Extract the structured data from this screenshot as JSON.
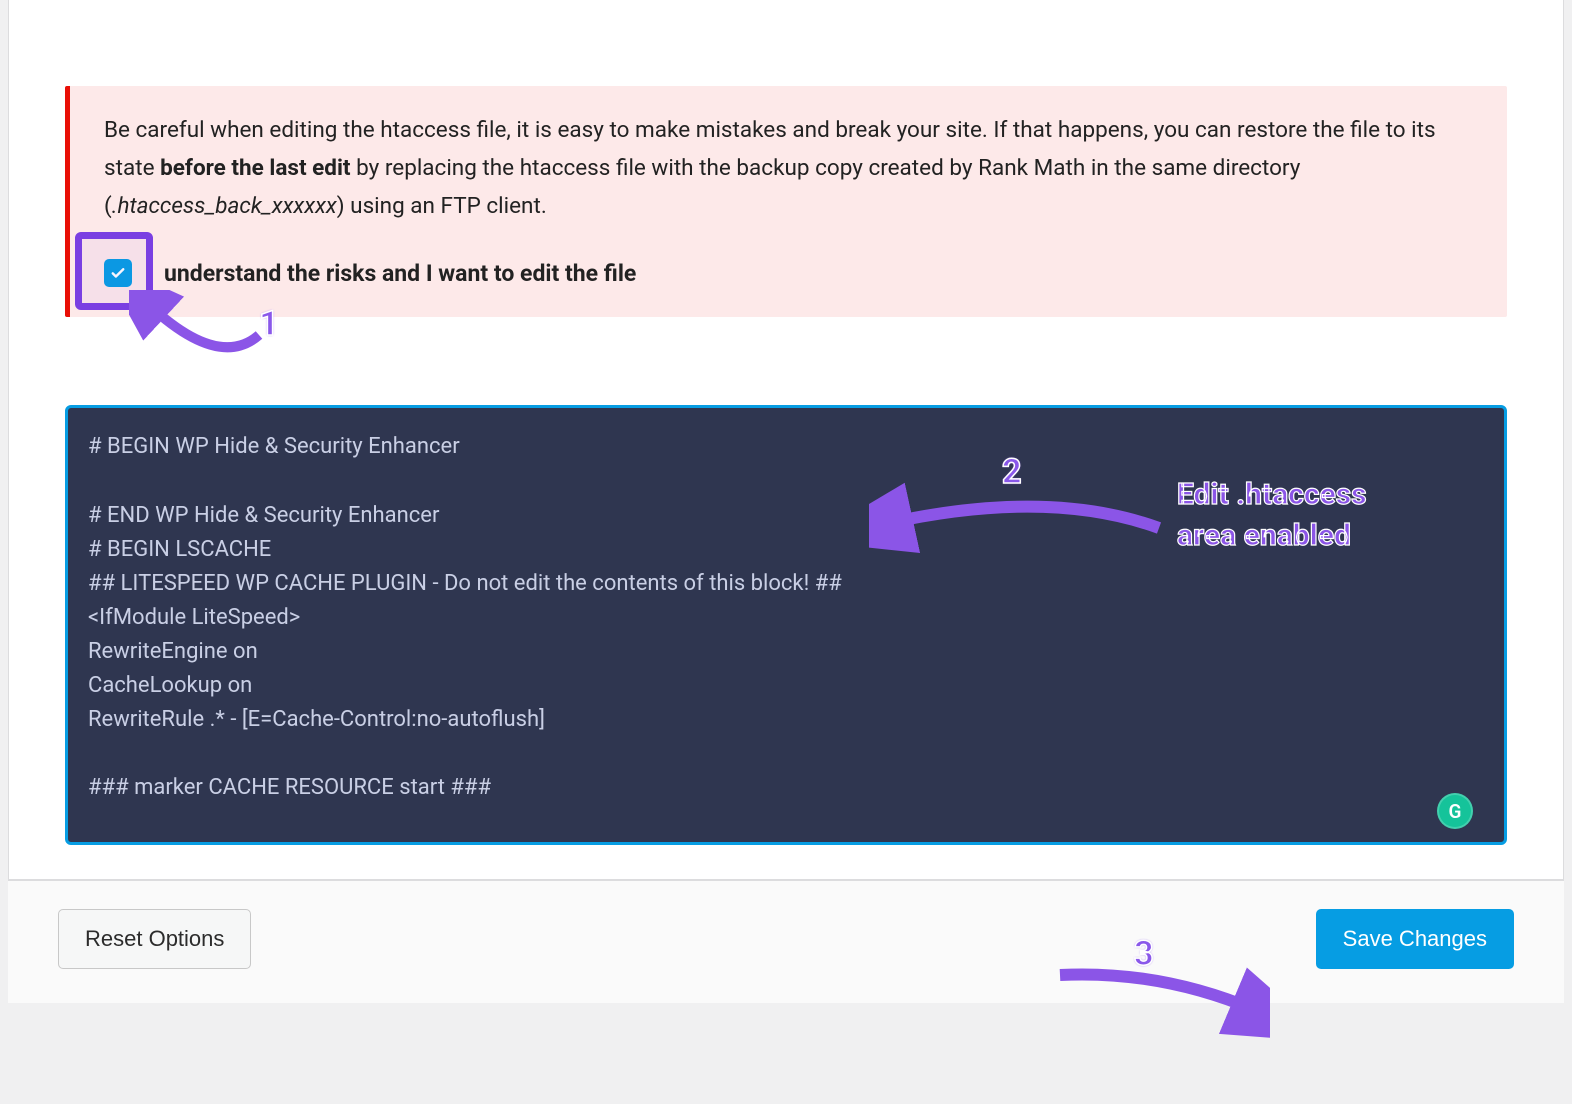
{
  "warning": {
    "text_before_bold": "Be careful when editing the htaccess file, it is easy to make mistakes and break your site. If that happens, you can restore the file to its state ",
    "bold": "before the last edit",
    "text_after_bold_before_italic": " by replacing the htaccess file with the backup copy created by Rank Math in the same directory (",
    "italic": ".htaccess_back_xxxxxx",
    "text_after_italic": ") using an FTP client.",
    "consent_label": "understand the risks and I want to edit the file",
    "consent_checked": true
  },
  "editor": {
    "content": "# BEGIN WP Hide & Security Enhancer\n\n# END WP Hide & Security Enhancer\n# BEGIN LSCACHE\n## LITESPEED WP CACHE PLUGIN - Do not edit the contents of this block! ##\n<IfModule LiteSpeed>\nRewriteEngine on\nCacheLookup on\nRewriteRule .* - [E=Cache-Control:no-autoflush]\n\n### marker CACHE RESOURCE start ###"
  },
  "footer": {
    "reset_label": "Reset Options",
    "save_label": "Save Changes"
  },
  "annotations": {
    "n1": "1",
    "n2": "2",
    "n3": "3",
    "label": "Edit .htaccess\narea enabled",
    "color": "#8b55e7"
  },
  "grammarly": {
    "letter": "G"
  }
}
